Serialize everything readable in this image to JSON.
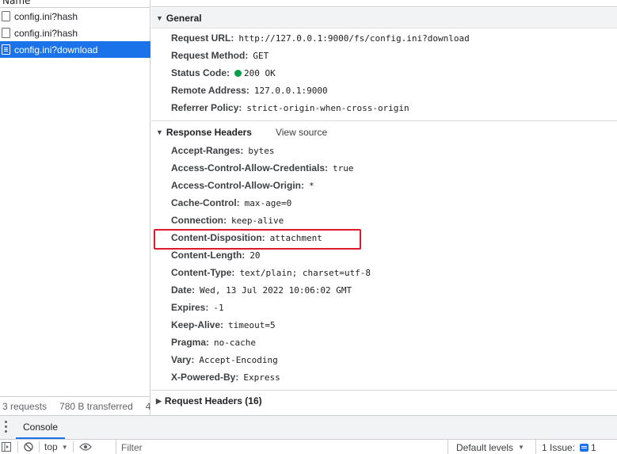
{
  "request_list": {
    "header": "Name",
    "items": [
      {
        "name": "config.ini?hash",
        "selected": false
      },
      {
        "name": "config.ini?hash",
        "selected": false
      },
      {
        "name": "config.ini?download",
        "selected": true
      }
    ],
    "summary": {
      "requests": "3 requests",
      "transferred": "780 B transferred",
      "more": "4"
    }
  },
  "general": {
    "title": "General",
    "rows": [
      {
        "name": "Request URL:",
        "value": "http://127.0.0.1:9000/fs/config.ini?download"
      },
      {
        "name": "Request Method:",
        "value": "GET"
      },
      {
        "name": "Status Code:",
        "value": "200 OK"
      },
      {
        "name": "Remote Address:",
        "value": "127.0.0.1:9000"
      },
      {
        "name": "Referrer Policy:",
        "value": "strict-origin-when-cross-origin"
      }
    ]
  },
  "response_headers": {
    "title": "Response Headers",
    "view_source": "View source",
    "rows": [
      {
        "name": "Accept-Ranges:",
        "value": "bytes"
      },
      {
        "name": "Access-Control-Allow-Credentials:",
        "value": "true"
      },
      {
        "name": "Access-Control-Allow-Origin:",
        "value": "*"
      },
      {
        "name": "Cache-Control:",
        "value": "max-age=0"
      },
      {
        "name": "Connection:",
        "value": "keep-alive"
      },
      {
        "name": "Content-Disposition:",
        "value": "attachment"
      },
      {
        "name": "Content-Length:",
        "value": "20"
      },
      {
        "name": "Content-Type:",
        "value": "text/plain; charset=utf-8"
      },
      {
        "name": "Date:",
        "value": "Wed, 13 Jul 2022 10:06:02 GMT"
      },
      {
        "name": "Expires:",
        "value": "-1"
      },
      {
        "name": "Keep-Alive:",
        "value": "timeout=5"
      },
      {
        "name": "Pragma:",
        "value": "no-cache"
      },
      {
        "name": "Vary:",
        "value": "Accept-Encoding"
      },
      {
        "name": "X-Powered-By:",
        "value": "Express"
      }
    ]
  },
  "request_headers": {
    "title": "Request Headers (16)"
  },
  "drawer": {
    "console_tab": "Console"
  },
  "console_toolbar": {
    "context": "top",
    "filter_placeholder": "Filter",
    "levels": "Default levels",
    "issues_label": "1 Issue:",
    "issues_count": "1"
  },
  "colors": {
    "accent": "#1a73e8",
    "status_ok": "#0a9e4b",
    "highlight": "#e0182b"
  }
}
